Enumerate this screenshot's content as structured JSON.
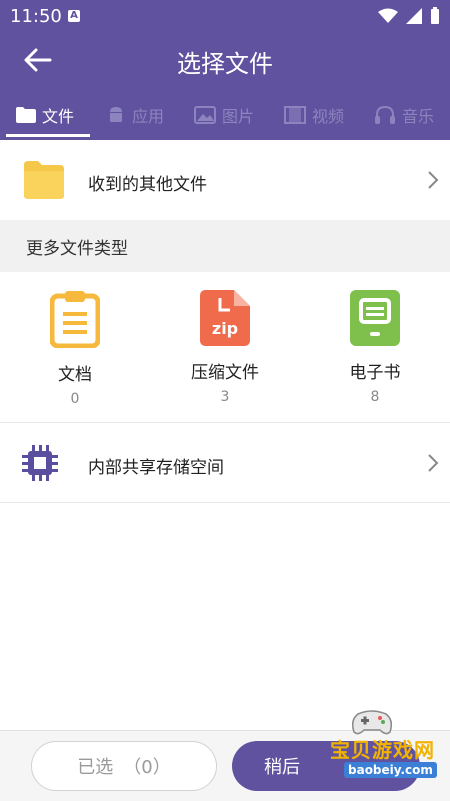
{
  "status": {
    "time": "11:50",
    "badge": "A"
  },
  "header": {
    "title": "选择文件"
  },
  "tabs": [
    {
      "label": "文件",
      "icon": "folder-icon",
      "active": true
    },
    {
      "label": "应用",
      "icon": "android-icon",
      "active": false
    },
    {
      "label": "图片",
      "icon": "image-icon",
      "active": false
    },
    {
      "label": "视频",
      "icon": "film-icon",
      "active": false
    },
    {
      "label": "音乐",
      "icon": "headphones-icon",
      "active": false
    }
  ],
  "received": {
    "label": "收到的其他文件",
    "icon": "folder-icon"
  },
  "section": {
    "title": "更多文件类型"
  },
  "types": [
    {
      "name": "文档",
      "count": "0",
      "icon": "clipboard-document-icon",
      "color": "#f6b93b"
    },
    {
      "name": "压缩文件",
      "count": "3",
      "icon": "zip-file-icon",
      "color": "#f06a4c",
      "badge": "zip"
    },
    {
      "name": "电子书",
      "count": "8",
      "icon": "ebook-icon",
      "color": "#7fbf4b"
    }
  ],
  "storage": {
    "label": "内部共享存储空间",
    "icon": "chip-icon"
  },
  "bottom": {
    "selected_label": "已选",
    "selected_count": "（0）",
    "later_label": "稍后"
  },
  "watermark": {
    "title": "宝贝游戏网",
    "url": "baobeiy.com"
  },
  "colors": {
    "primary": "#61529f",
    "folder": "#f6c84a",
    "zip": "#f06a4c",
    "doc": "#f6b93b",
    "ebook": "#7fbf4b",
    "chip": "#5a4f9e"
  }
}
